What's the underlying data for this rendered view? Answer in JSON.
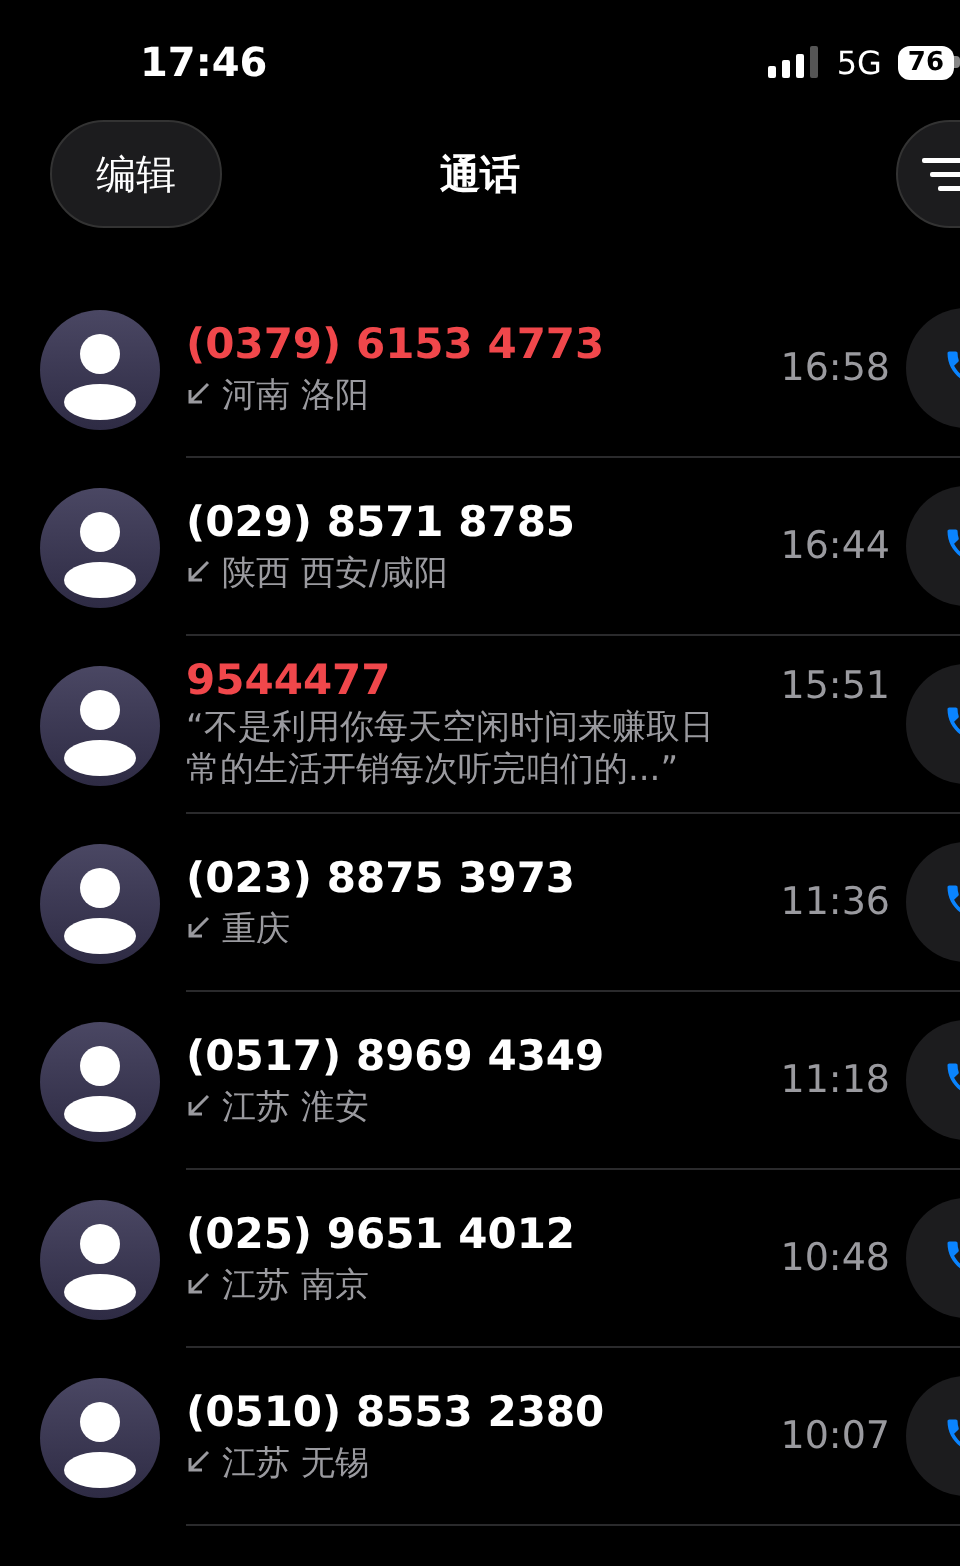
{
  "status_bar": {
    "time": "17:46",
    "network": "5G",
    "battery": "76"
  },
  "header": {
    "edit_button": "编辑",
    "title": "通话"
  },
  "calls": [
    {
      "number": "(0379) 6153 4773",
      "missed": true,
      "kind": "location",
      "detail": "河南 洛阳",
      "time": "16:58"
    },
    {
      "number": "(029) 8571 8785",
      "missed": false,
      "kind": "location",
      "detail": "陕西 西安/咸阳",
      "time": "16:44"
    },
    {
      "number": "9544477",
      "missed": true,
      "kind": "transcript",
      "detail": "“不是利用你每天空闲时间来赚取日常的生活开销每次听完咱们的...”",
      "time": "15:51"
    },
    {
      "number": "(023) 8875 3973",
      "missed": false,
      "kind": "location",
      "detail": "重庆",
      "time": "11:36"
    },
    {
      "number": "(0517) 8969 4349",
      "missed": false,
      "kind": "location",
      "detail": "江苏 淮安",
      "time": "11:18"
    },
    {
      "number": "(025) 9651 4012",
      "missed": false,
      "kind": "location",
      "detail": "江苏 南京",
      "time": "10:48"
    },
    {
      "number": "(0510) 8553 2380",
      "missed": false,
      "kind": "location",
      "detail": "江苏 无锡",
      "time": "10:07"
    }
  ]
}
